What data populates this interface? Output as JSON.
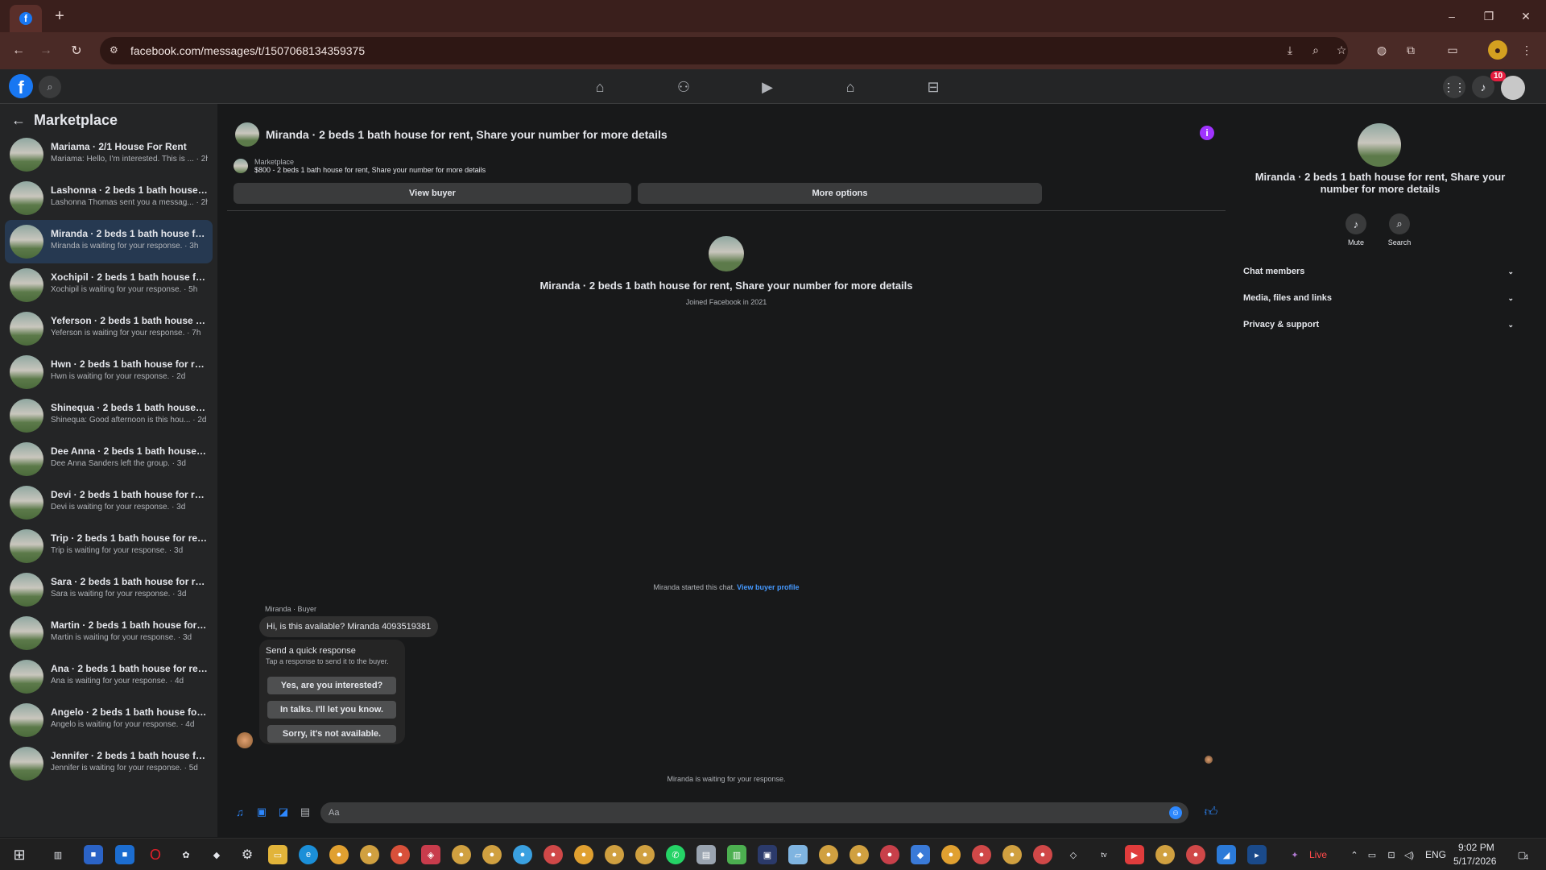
{
  "browser": {
    "url": "facebook.com/messages/t/1507068134359375",
    "new_tab_glyph": "+",
    "window_controls": {
      "minimize": "–",
      "restore": "❐",
      "close": "✕"
    }
  },
  "fb": {
    "notification_count": "10"
  },
  "left": {
    "title": "Marketplace",
    "conversations": [
      {
        "name": "Mariama · 2/1 House For Rent",
        "snippet": "Mariama: Hello, I'm interested. This is ... · 2h",
        "active": false
      },
      {
        "name": "Lashonna · 2 beds 1 bath house for...",
        "snippet": "Lashonna Thomas sent you a messag... · 2h",
        "active": false
      },
      {
        "name": "Miranda · 2 beds 1 bath house for ...",
        "snippet": "Miranda is waiting for your response. · 3h",
        "active": true
      },
      {
        "name": "Xochipil · 2 beds 1 bath house for r...",
        "snippet": "Xochipil is waiting for your response. · 5h",
        "active": false
      },
      {
        "name": "Yeferson · 2 beds 1 bath house for ...",
        "snippet": "Yeferson is waiting for your response. · 7h",
        "active": false
      },
      {
        "name": "Hwn · 2 beds 1 bath house for rent...",
        "snippet": "Hwn is waiting for your response. · 2d",
        "active": false
      },
      {
        "name": "Shinequa · 2 beds 1 bath house for...",
        "snippet": "Shinequa: Good afternoon is this hou... · 2d",
        "active": false
      },
      {
        "name": "Dee Anna · 2 beds 1 bath house fo...",
        "snippet": "Dee Anna Sanders left the group. · 3d",
        "active": false
      },
      {
        "name": "Devi · 2 beds 1 bath house for rent...",
        "snippet": "Devi is waiting for your response. · 3d",
        "active": false
      },
      {
        "name": "Trip · 2 beds 1 bath house for rent, ...",
        "snippet": "Trip is waiting for your response. · 3d",
        "active": false
      },
      {
        "name": "Sara · 2 beds 1 bath house for rent,...",
        "snippet": "Sara is waiting for your response. · 3d",
        "active": false
      },
      {
        "name": "Martin · 2 beds 1 bath house for re...",
        "snippet": "Martin is waiting for your response. · 3d",
        "active": false
      },
      {
        "name": "Ana · 2 beds 1 bath house for rent,...",
        "snippet": "Ana is waiting for your response. · 4d",
        "active": false
      },
      {
        "name": "Angelo · 2 beds 1 bath house for r...",
        "snippet": "Angelo is waiting for your response. · 4d",
        "active": false
      },
      {
        "name": "Jennifer · 2 beds 1 bath house for r...",
        "snippet": "Jennifer is waiting for your response. · 5d",
        "active": false
      }
    ]
  },
  "chat": {
    "title": "Miranda · 2 beds 1 bath house for rent, Share your number for more details",
    "marketplace_label": "Marketplace",
    "listing": "$800 - 2 beds 1 bath house for rent, Share your number for more details",
    "view_buyer": "View buyer",
    "more_options": "More options",
    "profile_name": "Miranda · 2 beds 1 bath house for rent, Share your number for more details",
    "joined": "Joined Facebook in 2021",
    "started_text": "Miranda started this chat.",
    "view_buyer_profile": "View buyer profile",
    "sender_label": "Miranda · Buyer",
    "message": "Hi, is this available? Miranda 4093519381",
    "quick_title": "Send a quick response",
    "quick_sub": "Tap a response to send it to the buyer.",
    "quick_responses": [
      "Yes, are you interested?",
      "In talks. I'll let you know.",
      "Sorry, it's not available."
    ],
    "waiting": "Miranda is waiting for your response.",
    "input_placeholder": "Aa"
  },
  "details": {
    "title": "Miranda · 2 beds 1 bath house for rent, Share your number for more details",
    "mute": "Mute",
    "search": "Search",
    "sections": [
      "Chat members",
      "Media, files and links",
      "Privacy & support"
    ]
  },
  "taskbar": {
    "live": "Live",
    "lang": "ENG",
    "time": "9:02 PM",
    "date": "5/17/2026",
    "notif_count": "4"
  },
  "colors": {
    "accent": "#1877f2",
    "link": "#4599ff",
    "info": "#a033ff",
    "active_row": "#263951"
  }
}
